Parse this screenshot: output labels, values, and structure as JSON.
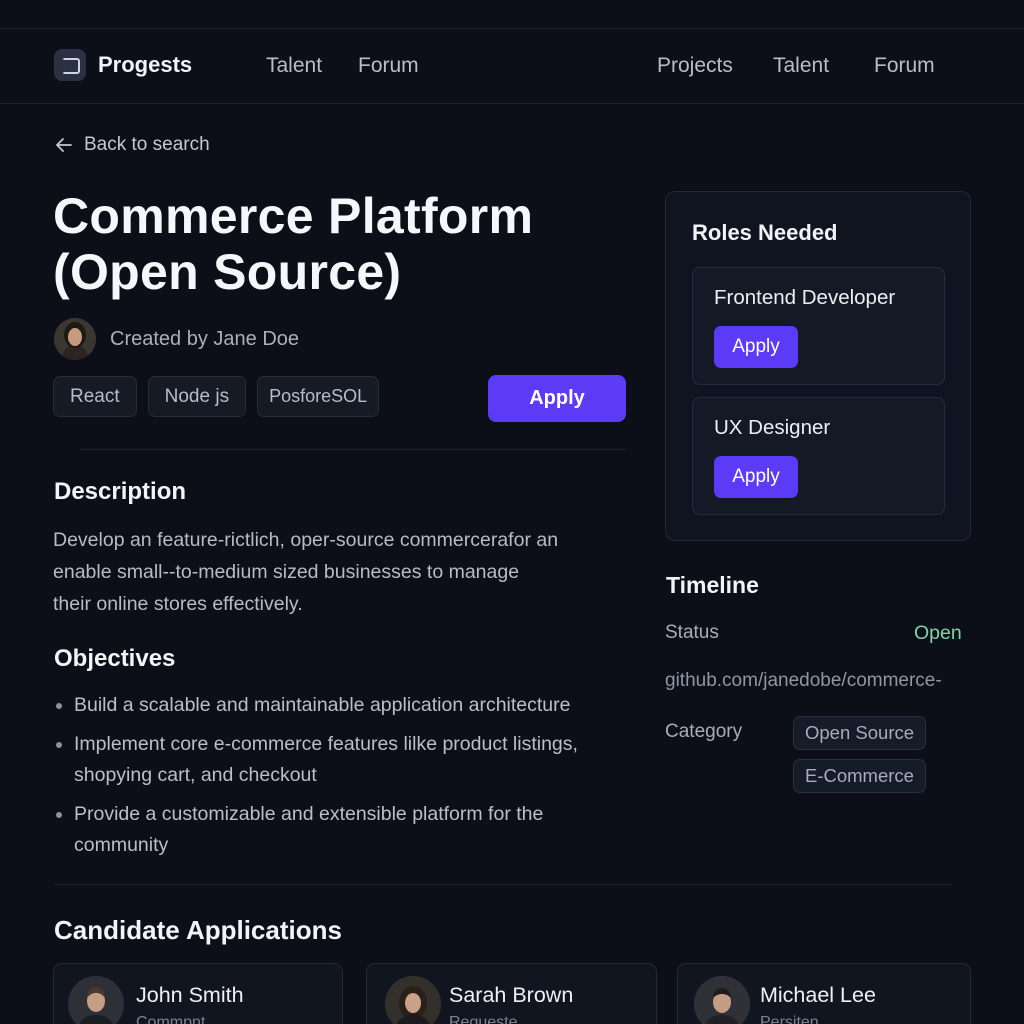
{
  "nav": {
    "logo_text": "Progests",
    "left_links": [
      "Talent",
      "Forum"
    ],
    "right_links": [
      "Projects",
      "Talent",
      "Forum"
    ]
  },
  "back_link": "Back to search",
  "project": {
    "title_line1": "Commerce Platform",
    "title_line2": "(Open Source)",
    "creator_text": "Created by Jane Doe",
    "tags": [
      "React",
      "Node js",
      "PosforeSOL"
    ],
    "apply_label": "Apply"
  },
  "description": {
    "heading": "Description",
    "lines": [
      "Develop an feature-rictlich, oper-source commercerafor an",
      "enable small--to-medium sized businesses to manage",
      "their online stores effectively."
    ]
  },
  "objectives": {
    "heading": "Objectives",
    "items": [
      "Build a scalable and maintainable application architecture",
      "Implement core e-commerce features lilke product listings, shopying cart, and checkout",
      "Provide a customizable and extensible platform for the community"
    ]
  },
  "roles": {
    "heading": "Roles Needed",
    "items": [
      {
        "name": "Frontend Developer",
        "apply_label": "Apply"
      },
      {
        "name": "UX Designer",
        "apply_label": "Apply"
      }
    ]
  },
  "timeline": {
    "heading": "Timeline",
    "status_label": "Status",
    "status_value": "Open",
    "repo_link": "github.com/janedobe/commerce-",
    "category_label": "Category",
    "categories": [
      "Open Source",
      "E-Commerce"
    ]
  },
  "candidates": {
    "heading": "Candidate Applications",
    "items": [
      {
        "name": "John Smith",
        "sub": "Commpnt"
      },
      {
        "name": "Sarah Brown",
        "sub": "Regueste"
      },
      {
        "name": "Michael Lee",
        "sub": "Persiten"
      }
    ]
  },
  "colors": {
    "background": "#0c0f17",
    "accent": "#5b3bf6",
    "status_open": "#7fd3a6"
  }
}
